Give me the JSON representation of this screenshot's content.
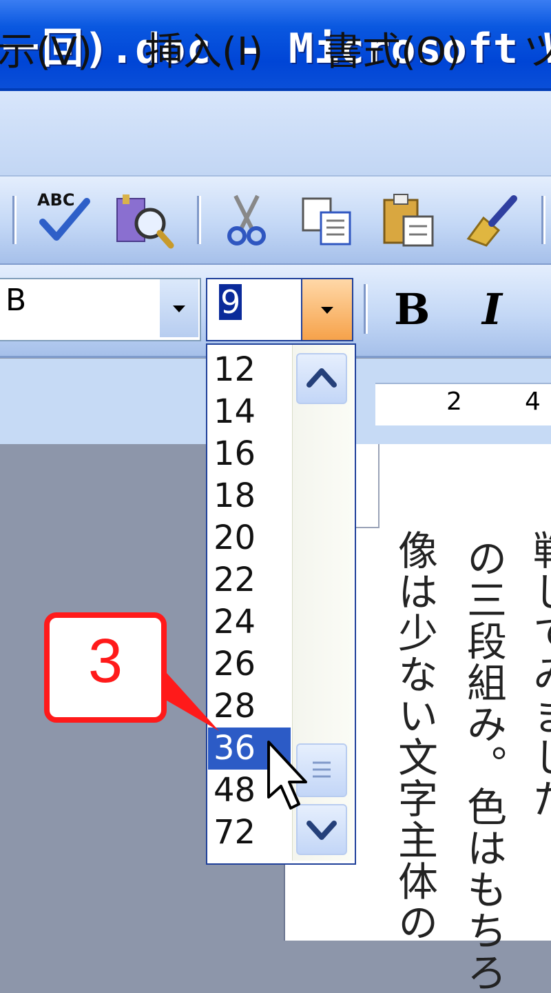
{
  "window": {
    "title": "ー回).doc - Microsoft W"
  },
  "menu": {
    "items": [
      "示(V)",
      "挿入(I)",
      "書式(O)",
      "ツ"
    ]
  },
  "toolbar": {
    "icons": [
      "spelling-check-icon",
      "research-icon",
      "cut-icon",
      "copy-icon",
      "paste-icon",
      "format-painter-icon"
    ]
  },
  "format": {
    "font_value": "B",
    "size_value": "9",
    "bold_label": "B",
    "italic_label": "I"
  },
  "font_size_dropdown": {
    "options": [
      "12",
      "14",
      "16",
      "18",
      "20",
      "22",
      "24",
      "26",
      "28",
      "36",
      "48",
      "72"
    ],
    "selected": "36"
  },
  "ruler": {
    "numbers": [
      "2",
      "4"
    ]
  },
  "document": {
    "columns": [
      "戦してみましだ",
      "の三段組み。色はもちろ",
      "像は少ない文字主体の"
    ]
  },
  "callout": {
    "label": "3",
    "color": "#ff1a1a"
  },
  "colors": {
    "title_bar": "#0a58e0",
    "selection": "#2c5bc6",
    "dropdown_button": "#f6a24a"
  }
}
